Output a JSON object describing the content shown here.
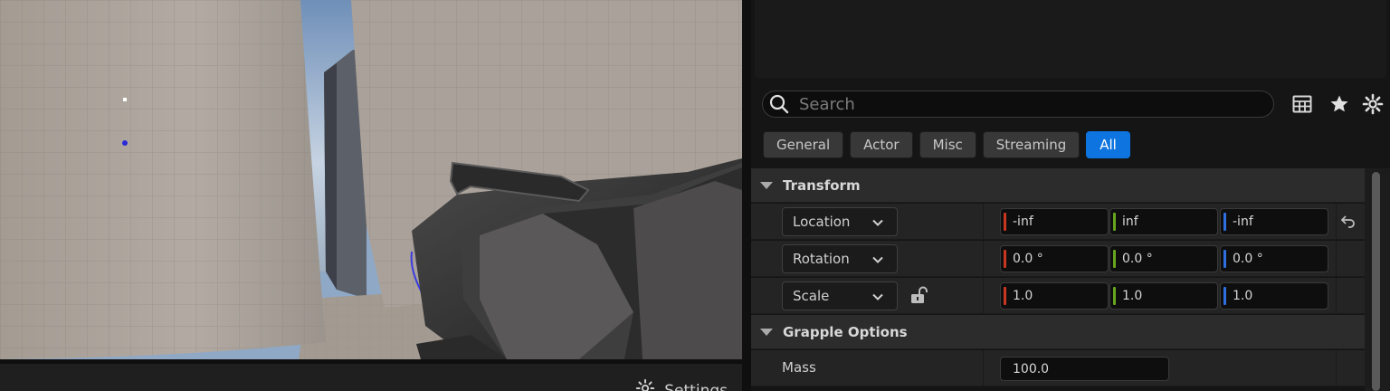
{
  "viewport": {
    "settings_label": "Settings",
    "settings_icon": "gear-icon"
  },
  "details": {
    "search": {
      "placeholder": "Search",
      "icon": "search-icon"
    },
    "toolbar": {
      "table_icon": "table-icon",
      "favorite_icon": "star-icon",
      "settings_icon": "gear-icon"
    },
    "filter_tabs": [
      {
        "label": "General",
        "active": false
      },
      {
        "label": "Actor",
        "active": false
      },
      {
        "label": "Misc",
        "active": false
      },
      {
        "label": "Streaming",
        "active": false
      },
      {
        "label": "All",
        "active": true
      }
    ],
    "transform": {
      "title": "Transform",
      "location": {
        "label": "Location",
        "x": "-inf",
        "y": "inf",
        "z": "-inf"
      },
      "rotation": {
        "label": "Rotation",
        "x": "0.0 °",
        "y": "0.0 °",
        "z": "0.0 °"
      },
      "scale": {
        "label": "Scale",
        "x": "1.0",
        "y": "1.0",
        "z": "1.0"
      }
    },
    "grapple_options": {
      "title": "Grapple Options",
      "mass": {
        "label": "Mass",
        "value": "100.0"
      }
    }
  },
  "colors": {
    "accent": "#0e74e0",
    "axis_x": "#c8371f",
    "axis_y": "#66a51d",
    "axis_z": "#2f6fe0",
    "panel_bg": "#151515",
    "row_bg": "#242424"
  }
}
